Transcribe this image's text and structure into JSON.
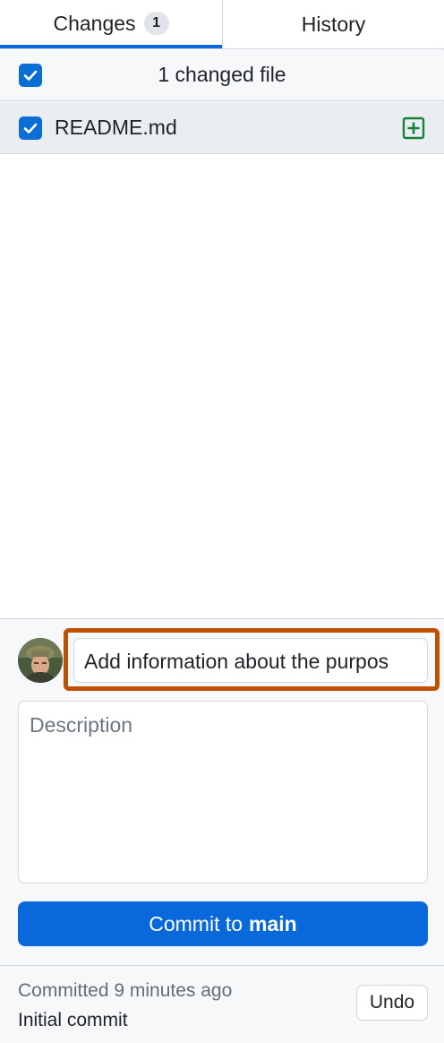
{
  "tabs": {
    "changes_label": "Changes",
    "changes_count": "1",
    "history_label": "History"
  },
  "changes": {
    "summary": "1 changed file",
    "all_selected": true,
    "files": [
      {
        "name": "README.md",
        "checked": true,
        "status_icon": "file-added-icon"
      }
    ]
  },
  "commit": {
    "summary_value": "Add information about the purpos",
    "description_placeholder": "Description",
    "button_prefix": "Commit to",
    "branch": "main",
    "highlight_color": "#bf5000",
    "button_color": "#0969da"
  },
  "last_commit": {
    "time_text": "Committed 9 minutes ago",
    "title": "Initial commit",
    "undo_label": "Undo"
  },
  "colors": {
    "accent": "#0969da",
    "checkbox": "#0b6ed5",
    "added": "#1a7f37"
  }
}
